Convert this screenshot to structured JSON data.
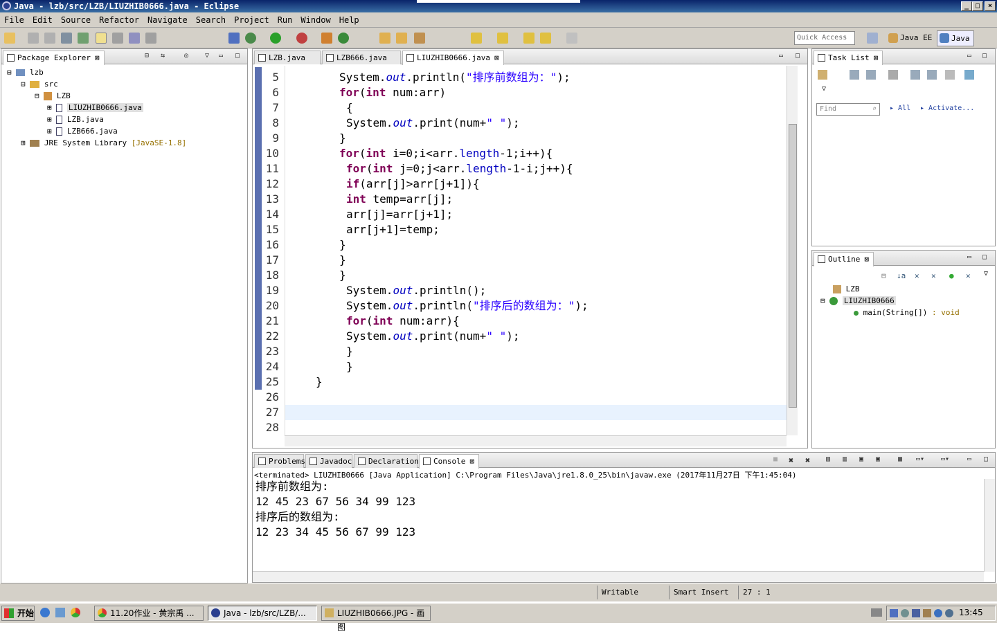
{
  "window": {
    "title": "Java - lzb/src/LZB/LIUZHIB0666.java - Eclipse"
  },
  "menu": [
    "File",
    "Edit",
    "Source",
    "Refactor",
    "Navigate",
    "Search",
    "Project",
    "Run",
    "Window",
    "Help"
  ],
  "toolbar": {
    "quick_access_placeholder": "Quick Access",
    "perspective_java_ee": "Java EE",
    "perspective_java": "Java"
  },
  "package_explorer": {
    "tab_label": "Package Explorer",
    "tree": [
      {
        "label": "lzb"
      },
      {
        "label": "src"
      },
      {
        "label": "LZB"
      },
      {
        "label": "LIUZHIB0666.java"
      },
      {
        "label": "LZB.java"
      },
      {
        "label": "LZB666.java"
      },
      {
        "label": "JRE System Library",
        "suffix": "[JavaSE-1.8]"
      }
    ]
  },
  "editor": {
    "tabs": [
      {
        "label": "LZB.java"
      },
      {
        "label": "LZB666.java"
      },
      {
        "label": "LIUZHIB0666.java"
      }
    ],
    "line_numbers": [
      "5",
      "6",
      "7",
      "8",
      "9",
      "10",
      "11",
      "12",
      "13",
      "14",
      "15",
      "16",
      "17",
      "18",
      "19",
      "20",
      "21",
      "22",
      "23",
      "24",
      "25",
      "26",
      "27",
      "28"
    ]
  },
  "task_list": {
    "tab_label": "Task List",
    "find_placeholder": "Find",
    "all_label": "All",
    "activate_label": "Activate..."
  },
  "outline": {
    "tab_label": "Outline",
    "items": [
      {
        "label": "LZB"
      },
      {
        "label": "LIUZHIB0666"
      },
      {
        "label": "main(String[])",
        "type": ": void"
      }
    ]
  },
  "bottom_tabs": [
    {
      "label": "Problems"
    },
    {
      "label": "Javadoc"
    },
    {
      "label": "Declaration"
    },
    {
      "label": "Console"
    }
  ],
  "console": {
    "header": "<terminated> LIUZHIB0666 [Java Application] C:\\Program Files\\Java\\jre1.8.0_25\\bin\\javaw.exe (2017年11月27日 下午1:45:04)",
    "lines": [
      "排序前数组为:",
      "12 45 23 67 56 34 99 123",
      "排序后的数组为:",
      "12 23 34 45 56 67 99 123"
    ]
  },
  "status": {
    "writable": "Writable",
    "insert_mode": "Smart Insert",
    "position": "27 : 1"
  },
  "taskbar": {
    "start_label": "开始",
    "tasks": [
      {
        "label": "11.20作业 - 黄宗禹 ..."
      },
      {
        "label": "Java - lzb/src/LZB/..."
      },
      {
        "label": "LIUZHIB0666.JPG - 画图"
      }
    ],
    "clock": "13:45"
  },
  "colors": {
    "keyword": "#7f0055",
    "field": "#0000c0",
    "string": "#2a00ff",
    "current_line": "#e8f2fe",
    "title_bar": "#0a246a"
  }
}
